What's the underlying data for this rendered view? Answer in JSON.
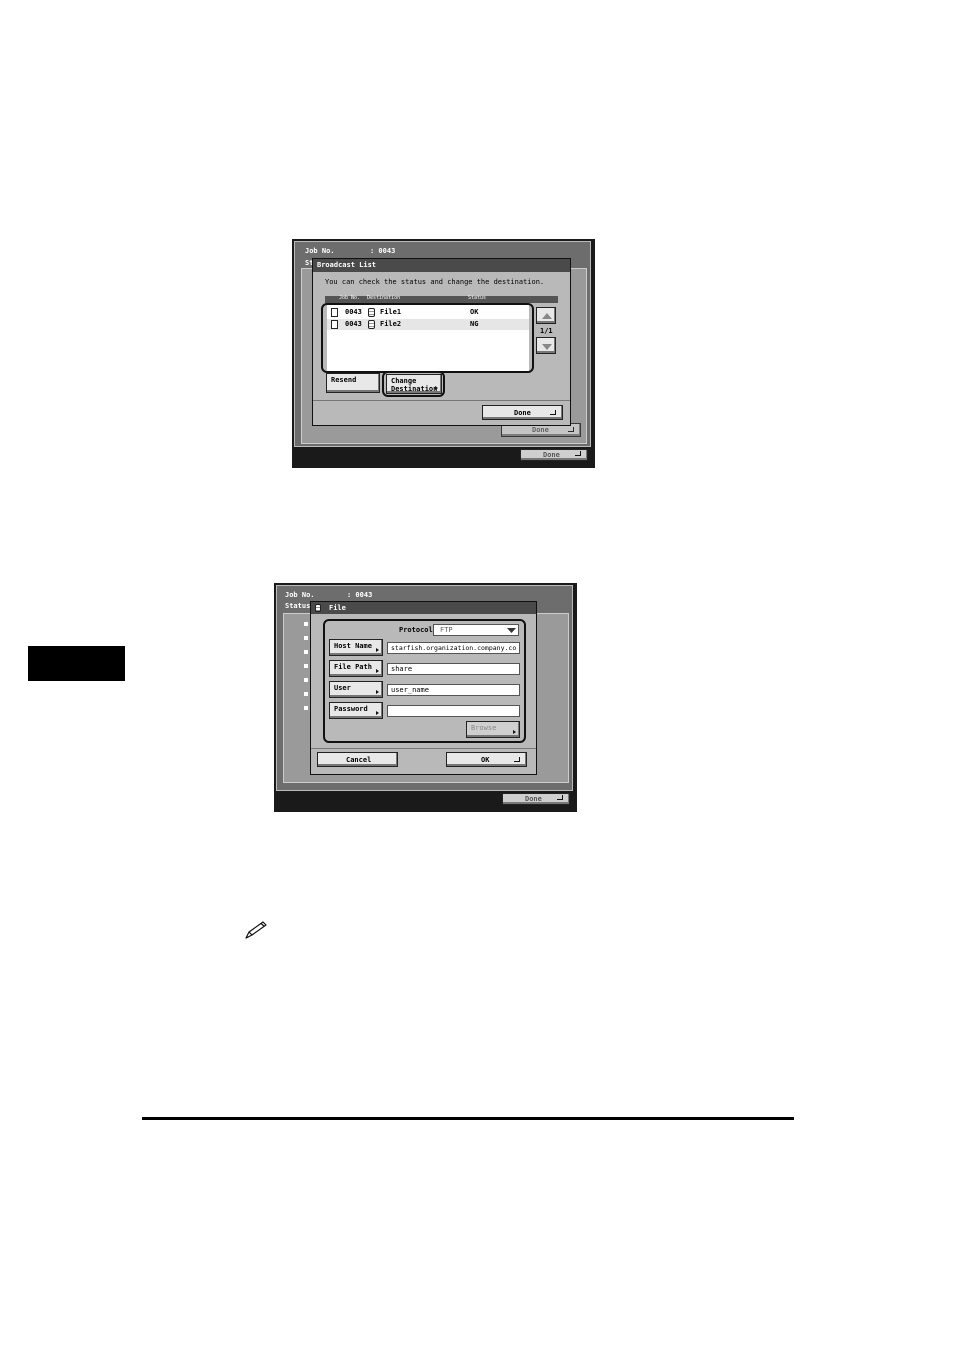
{
  "screen1": {
    "job_label": "Job No.",
    "job_value": ": 0043",
    "st_label": "St",
    "dialog_title": "Broadcast List",
    "instruction": "You can check the status and change the destination.",
    "columns": [
      "Job No.",
      "Destination",
      "Status"
    ],
    "rows": [
      {
        "job": "0043",
        "destination": "File1",
        "status": "OK"
      },
      {
        "job": "0043",
        "destination": "File2",
        "status": "NG"
      }
    ],
    "page": "1/1",
    "resend_label": "Resend",
    "change_label_1": "Change",
    "change_label_2": "Destination",
    "done_label": "Done",
    "bg_done_label": "Done",
    "bottom_done_label": "Done"
  },
  "screen2": {
    "job_label": "Job No.",
    "job_value": ": 0043",
    "status_label": "Status",
    "dialog_title": "File",
    "protocol_label": "Protocol:",
    "protocol_value": "FTP",
    "host_name_label": "Host Name",
    "host_name_value": "starfish.organization.company.co",
    "file_path_label": "File Path",
    "file_path_value": "share",
    "user_label": "User",
    "user_value": "user_name",
    "password_label": "Password",
    "password_value": "",
    "browse_label": "Browse",
    "cancel_label": "Cancel",
    "ok_label": "OK",
    "bottom_done_label": "Done"
  }
}
